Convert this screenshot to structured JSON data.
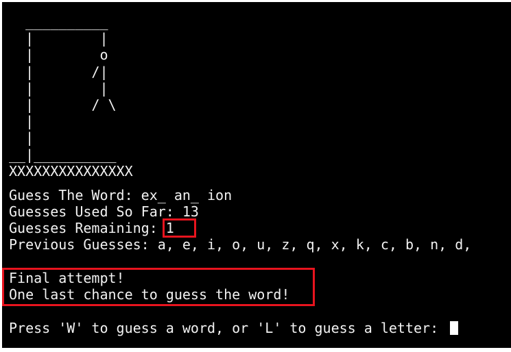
{
  "colors": {
    "terminal_background": "#000000",
    "terminal_text": "#f2f2f2",
    "annotation_box": "#e8141e"
  },
  "gallows_art": "  __________\n  |        |\n  |        o\n  |       /|\n  |        |\n  |       / \\\n  |\n  |\n__|__________\nXXXXXXXXXXXXXXX",
  "game": {
    "word_label": "Guess The Word: ",
    "word_value": "ex_ an_ ion",
    "used_label": "Guesses Used So Far: ",
    "used_value": "13",
    "remaining_label": "Guesses Remaining: ",
    "remaining_value": "1",
    "previous_label": "Previous Guesses: ",
    "previous_value": "a, e, i, o, u, z, q, x, k, c, b, n, d,",
    "final_attempt": "Final attempt!",
    "last_chance": "One last chance to guess the word!",
    "prompt": "Press 'W' to guess a word, or 'L' to guess a letter: "
  }
}
